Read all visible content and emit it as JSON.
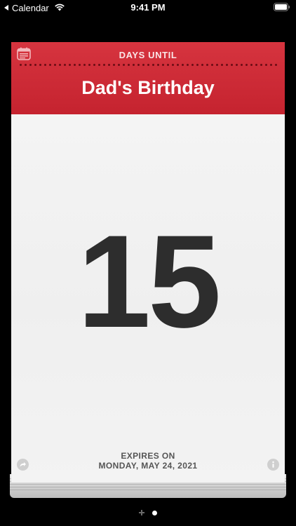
{
  "status_bar": {
    "back_app_label": "Calendar",
    "time": "9:41 PM",
    "icons": [
      "back-caret-icon",
      "wifi-icon",
      "battery-icon"
    ]
  },
  "countdown": {
    "header_label": "DAYS UNTIL",
    "event_title": "Dad's Birthday",
    "days_remaining": "15",
    "expires_label": "EXPIRES ON",
    "expires_date": "MONDAY, MAY 24, 2021",
    "header_icon": "calendar-icon",
    "footer_icons": [
      "share-icon",
      "info-icon"
    ]
  },
  "page_indicator": {
    "pages": 1,
    "current_page": 1,
    "add_icon": "plus-icon"
  },
  "colors": {
    "header_red": "#cc2b36",
    "page_background": "#f2f2f2",
    "count_text": "#2d2d2d",
    "screen_background": "#000000"
  }
}
